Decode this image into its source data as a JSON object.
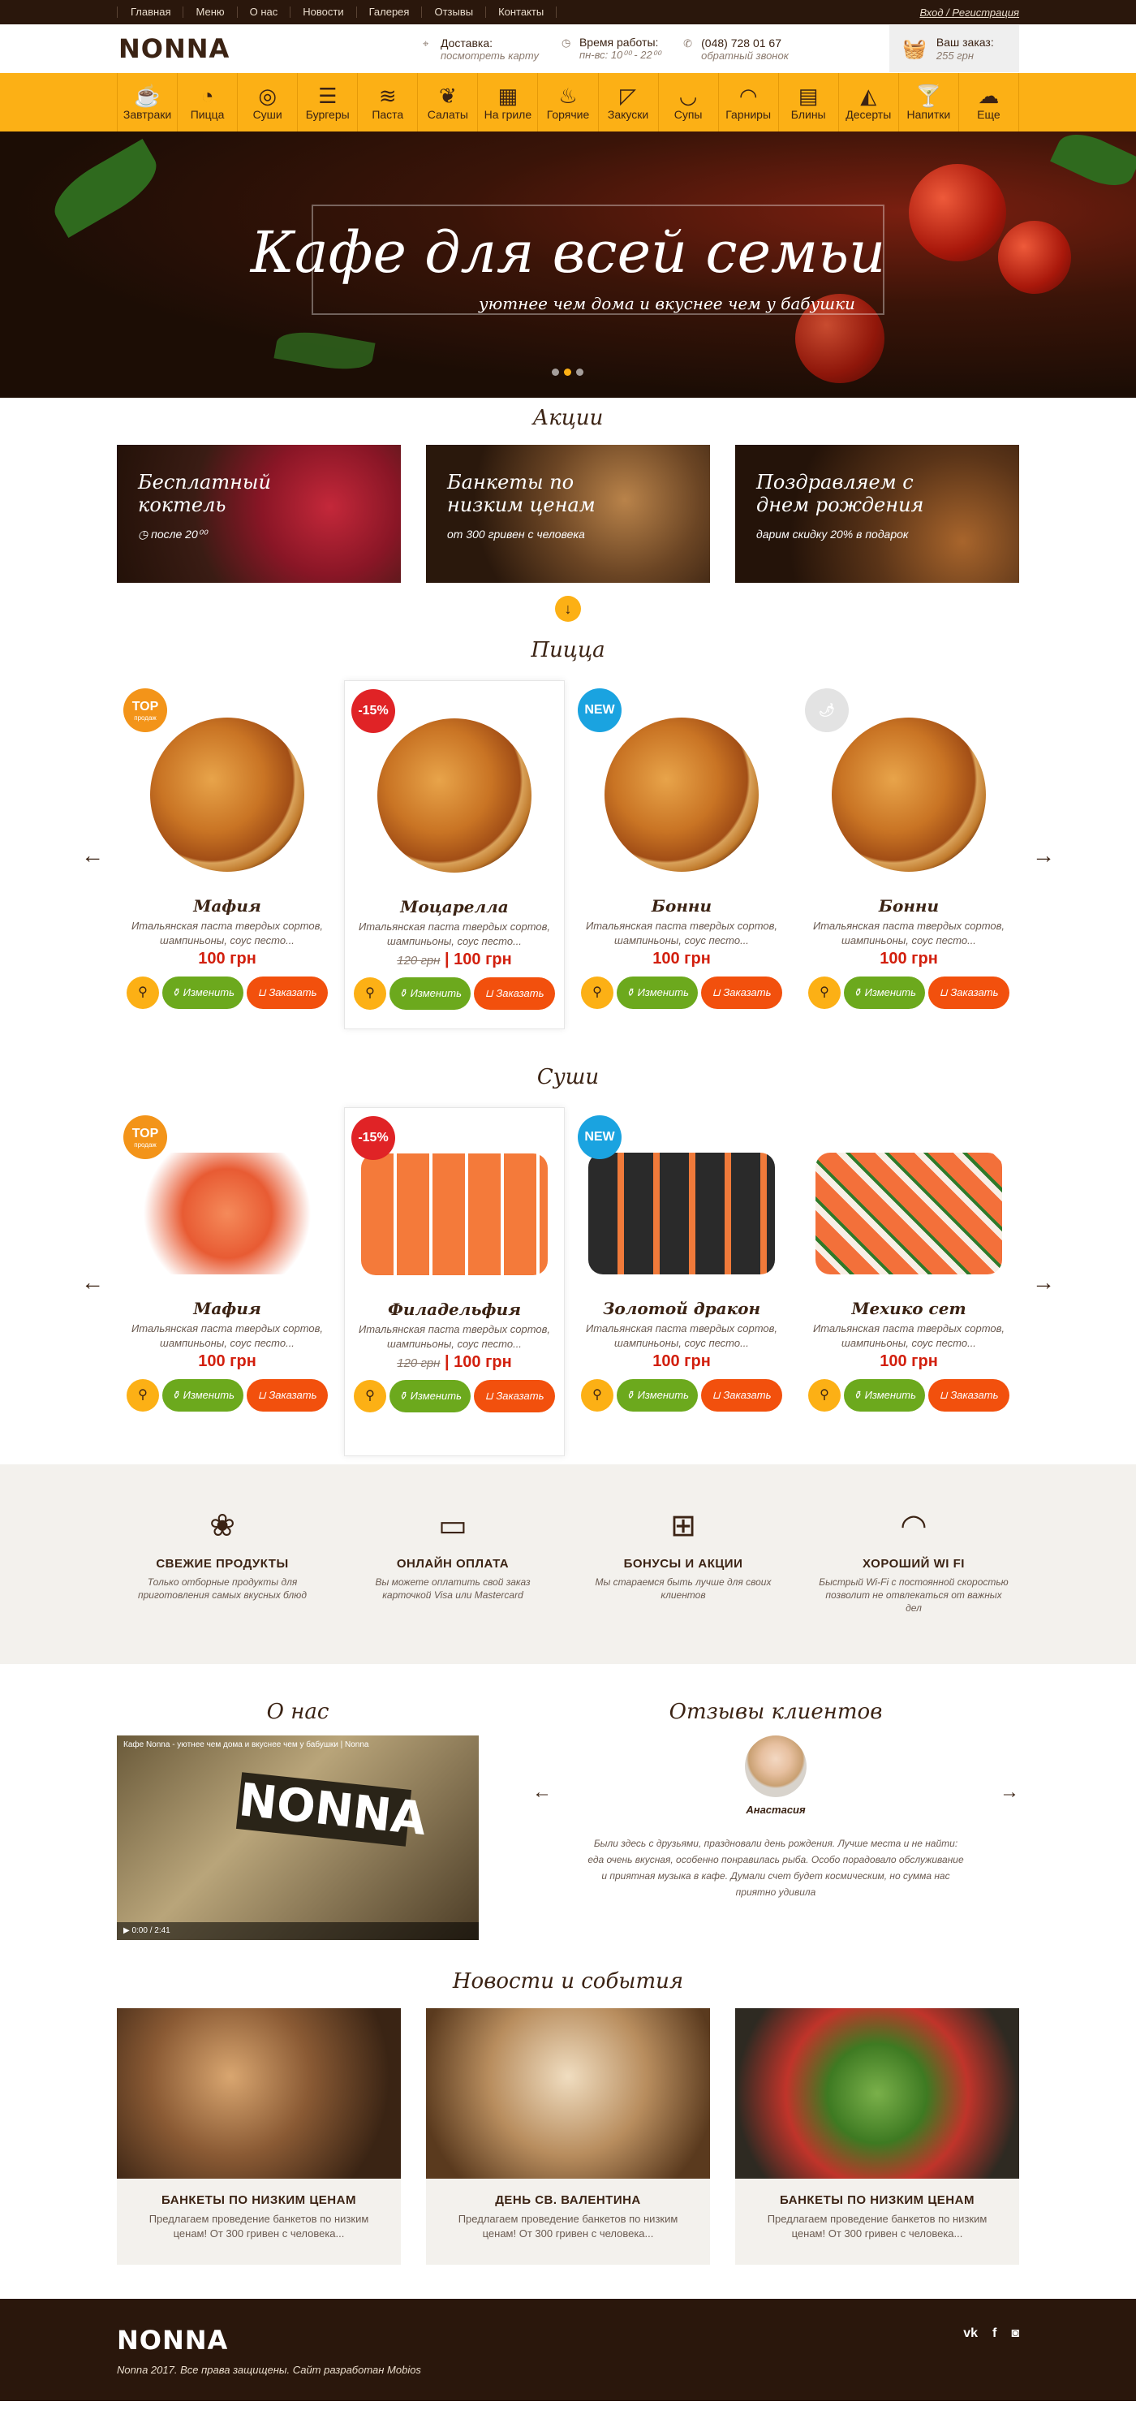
{
  "topnav": {
    "items": [
      "Главная",
      "Меню",
      "О нас",
      "Новости",
      "Галерея",
      "Отзывы",
      "Контакты"
    ],
    "login": "Вход / Регистрация"
  },
  "header": {
    "logo": "NONNA",
    "delivery": {
      "title": "Доставка:",
      "sub": "посмотреть карту"
    },
    "hours": {
      "title": "Время работы:",
      "sub": "пн-вс: 10⁰⁰ - 22⁰⁰"
    },
    "phone": {
      "title": "(048) 728 01 67",
      "sub": "обратный звонок"
    },
    "cart": {
      "title": "Ваш заказ:",
      "sub": "255 грн"
    }
  },
  "categories": [
    {
      "label": "Завтраки",
      "icon": "breakfast-icon",
      "glyph": "☕"
    },
    {
      "label": "Пицца",
      "icon": "pizza-icon",
      "glyph": "◔"
    },
    {
      "label": "Суши",
      "icon": "sushi-icon",
      "glyph": "◎"
    },
    {
      "label": "Бургеры",
      "icon": "burger-icon",
      "glyph": "☰"
    },
    {
      "label": "Паста",
      "icon": "pasta-icon",
      "glyph": "≋"
    },
    {
      "label": "Салаты",
      "icon": "salad-icon",
      "glyph": "❦"
    },
    {
      "label": "На гриле",
      "icon": "grill-icon",
      "glyph": "▦"
    },
    {
      "label": "Горячие",
      "icon": "hot-dish-icon",
      "glyph": "♨"
    },
    {
      "label": "Закуски",
      "icon": "snack-icon",
      "glyph": "◸"
    },
    {
      "label": "Супы",
      "icon": "soup-icon",
      "glyph": "◡"
    },
    {
      "label": "Гарниры",
      "icon": "garnish-icon",
      "glyph": "◠"
    },
    {
      "label": "Блины",
      "icon": "pancakes-icon",
      "glyph": "▤"
    },
    {
      "label": "Десерты",
      "icon": "dessert-icon",
      "glyph": "◭"
    },
    {
      "label": "Напитки",
      "icon": "drinks-icon",
      "glyph": "🍸"
    },
    {
      "label": "Еще",
      "icon": "more-icon",
      "glyph": "☁"
    }
  ],
  "hero": {
    "title": "Кафе для всей семьи",
    "subtitle": "уютнее чем дома и вкуснее чем у бабушки"
  },
  "promos": {
    "title": "Акции",
    "items": [
      {
        "title": "Бесплатный коктель",
        "sub": "после 20⁰⁰"
      },
      {
        "title": "Банкеты по низким ценам",
        "sub": "от 300 гривен с человека"
      },
      {
        "title": "Поздравляем с днем рождения",
        "sub": "дарим скидку 20% в подарок"
      }
    ]
  },
  "pizza": {
    "title": "Пицца",
    "items": [
      {
        "name": "Мафия",
        "desc": "Итальянская паста твердых сортов, шампиньоны, соус песто...",
        "price": "100 грн",
        "old": "",
        "badge": "TOP",
        "badge_sub": "продаж"
      },
      {
        "name": "Моцарелла",
        "desc": "Итальянская паста твердых сортов, шампиньоны, соус песто...",
        "price": "100 грн",
        "old": "120 грн",
        "badge": "-15%",
        "badge_sub": ""
      },
      {
        "name": "Бонни",
        "desc": "Итальянская паста твердых сортов, шампиньоны, соус песто...",
        "price": "100 грн",
        "old": "",
        "badge": "NEW",
        "badge_sub": ""
      },
      {
        "name": "Бонни",
        "desc": "Итальянская паста твердых сортов, шампиньоны, соус песто...",
        "price": "100 грн",
        "old": "",
        "badge": "🌶",
        "badge_sub": ""
      }
    ]
  },
  "sushi": {
    "title": "Суши",
    "items": [
      {
        "name": "Мафия",
        "desc": "Итальянская паста твердых сортов, шампиньоны, соус песто...",
        "price": "100 грн",
        "old": "",
        "badge": "TOP",
        "badge_sub": "продаж"
      },
      {
        "name": "Филадельфия",
        "desc": "Итальянская паста твердых сортов, шампиньоны, соус песто...",
        "price": "100 грн",
        "old": "120 грн",
        "badge": "-15%",
        "badge_sub": ""
      },
      {
        "name": "Золотой дракон",
        "desc": "Итальянская паста твердых сортов, шампиньоны, соус песто...",
        "price": "100 грн",
        "old": "",
        "badge": "NEW",
        "badge_sub": ""
      },
      {
        "name": "Мехико сет",
        "desc": "Итальянская паста твердых сортов, шампиньоны, соус песто...",
        "price": "100 грн",
        "old": "",
        "badge": "",
        "badge_sub": ""
      }
    ]
  },
  "buttons": {
    "edit": "Изменить",
    "order": "Заказать"
  },
  "features": [
    {
      "title": "СВЕЖИЕ ПРОДУКТЫ",
      "text": "Только отборные продукты для приготовления самых вкусных блюд",
      "icon": "broccoli-icon",
      "glyph": "❀"
    },
    {
      "title": "ОНЛАЙН ОПЛАТА",
      "text": "Вы можете оплатить свой заказ карточкой Visa или Mastercard",
      "icon": "card-icon",
      "glyph": "▭"
    },
    {
      "title": "БОНУСЫ И АКЦИИ",
      "text": "Мы стараемся быть лучше для своих клиентов",
      "icon": "gift-icon",
      "glyph": "⊞"
    },
    {
      "title": "ХОРОШИЙ WI FI",
      "text": "Быстрый Wi-Fi с постоянной скоростью позволит не отвлекаться от важных дел",
      "icon": "wifi-icon",
      "glyph": "◠"
    }
  ],
  "about": {
    "title": "О нас",
    "video_title": "Кафе Nonna - уютнее чем дома и вкуснее чем у бабушки | Nonna",
    "video_sign": "NONNA",
    "video_time": "0:00 / 2:41"
  },
  "reviews": {
    "title": "Отзывы клиентов",
    "name": "Анастасия",
    "text": "Были здесь с друзьями, праздновали день рождения. Лучше места и не найти: еда очень вкусная, особенно понравилась рыба. Особо порадовало обслуживание и приятная музыка в кафе. Думали счет будет космическим, но сумма нас приятно удивила"
  },
  "news": {
    "title": "Новости и события",
    "items": [
      {
        "title": "БАНКЕТЫ ПО НИЗКИМ ЦЕНАМ",
        "text": "Предлагаем проведение банкетов по низким ценам! От 300 гривен с человека..."
      },
      {
        "title": "ДЕНЬ СВ. ВАЛЕНТИНА",
        "text": "Предлагаем проведение банкетов по низким ценам! От 300 гривен с человека..."
      },
      {
        "title": "БАНКЕТЫ ПО НИЗКИМ ЦЕНАМ",
        "text": "Предлагаем проведение банкетов по низким ценам! От 300 гривен с человека..."
      }
    ]
  },
  "footer": {
    "logo": "NONNA",
    "copy": "Nonna 2017. Все права защищены. Сайт разработан Mobios",
    "social": [
      "vk",
      "f",
      "◙"
    ]
  },
  "colors": {
    "accent": "#fcb015",
    "dark": "#2a170c",
    "green": "#6ca91d",
    "orange": "#f2500d",
    "red": "#d21f0d",
    "badge_top": "#f39419",
    "badge_sale": "#e02326",
    "badge_new": "#1aa3e0"
  }
}
